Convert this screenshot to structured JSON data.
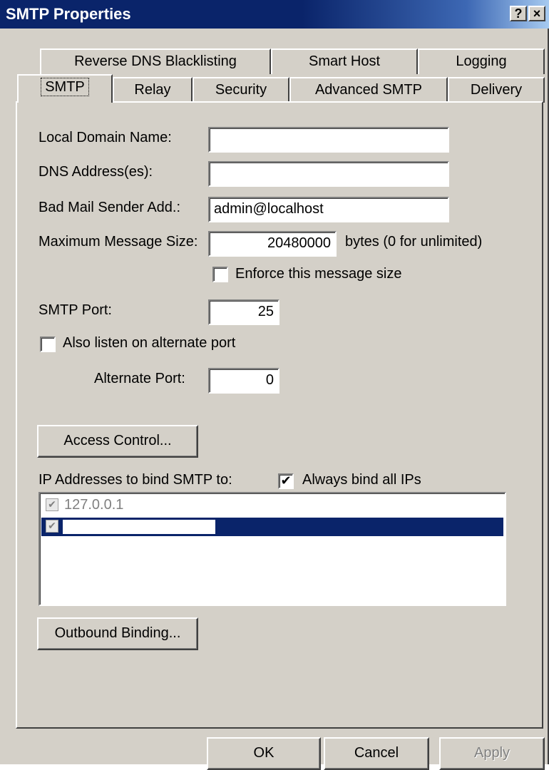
{
  "window": {
    "title": "SMTP Properties",
    "help_glyph": "?",
    "close_glyph": "×"
  },
  "tabs": {
    "back_row": [
      "Reverse DNS Blacklisting",
      "Smart Host",
      "Logging"
    ],
    "front_row": [
      "SMTP",
      "Relay",
      "Security",
      "Advanced SMTP",
      "Delivery"
    ],
    "active": "SMTP"
  },
  "form": {
    "local_domain_label": "Local Domain Name:",
    "local_domain_value": "",
    "dns_label": "DNS Address(es):",
    "dns_value": "",
    "bad_mail_label": "Bad Mail Sender Add.:",
    "bad_mail_value": "admin@localhost",
    "max_size_label": "Maximum Message Size:",
    "max_size_value": "20480000",
    "max_size_unit": "bytes (0 for unlimited)",
    "enforce_label": "Enforce this message size",
    "enforce_checked": false,
    "smtp_port_label": "SMTP Port:",
    "smtp_port_value": "25",
    "alt_listen_label": "Also listen on alternate port",
    "alt_listen_checked": false,
    "alt_port_label": "Alternate Port:",
    "alt_port_value": "0",
    "access_control_button": "Access Control...",
    "ip_bind_label": "IP Addresses to bind SMTP to:",
    "always_bind_label": "Always bind all IPs",
    "always_bind_checked": true,
    "ip_list": [
      {
        "address": "127.0.0.1",
        "checked": true,
        "selected": false
      },
      {
        "address": "",
        "checked": true,
        "selected": true
      }
    ],
    "outbound_binding_button": "Outbound Binding..."
  },
  "footer": {
    "ok": "OK",
    "cancel": "Cancel",
    "apply": "Apply"
  },
  "colors": {
    "face": "#d4d0c8",
    "titlebar": "#0a246a",
    "selection": "#0a246a"
  }
}
